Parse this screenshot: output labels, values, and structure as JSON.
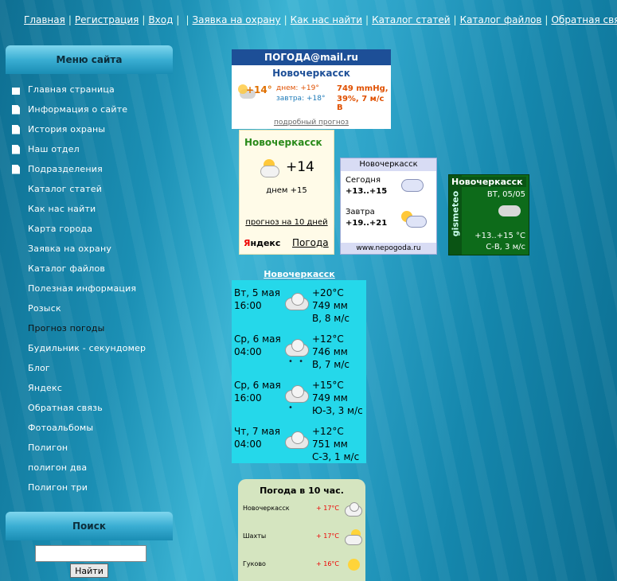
{
  "colors": {
    "accent": "#1a8db4",
    "menu_active": "#111111",
    "widget_cyan": "#25d8ea"
  },
  "topnav": [
    "Главная",
    "Регистрация",
    "Вход",
    "",
    "Заявка на охрану",
    "Как нас найти",
    "Каталог статей",
    "Каталог файлов",
    "Обратная связь"
  ],
  "sidebar": {
    "menu_title": "Меню сайта",
    "items": [
      {
        "label": "Главная страница",
        "icon": "home-icon"
      },
      {
        "label": "Информация о сайте",
        "icon": "document-icon"
      },
      {
        "label": "История охраны",
        "icon": "document-icon"
      },
      {
        "label": "Наш отдел",
        "icon": "document-icon"
      },
      {
        "label": "Подразделения",
        "icon": "document-icon"
      },
      {
        "label": "Каталог статей"
      },
      {
        "label": "Как нас найти"
      },
      {
        "label": "Карта города"
      },
      {
        "label": "Заявка на охрану"
      },
      {
        "label": "Каталог файлов"
      },
      {
        "label": "Полезная информация"
      },
      {
        "label": "Розыск"
      },
      {
        "label": "Прогноз погоды",
        "active": true
      },
      {
        "label": "Будильник - секундомер"
      },
      {
        "label": "Блог"
      },
      {
        "label": "Яндекс"
      },
      {
        "label": "Обратная связь"
      },
      {
        "label": "Фотоальбомы"
      },
      {
        "label": "Полигон"
      },
      {
        "label": "полигон два"
      },
      {
        "label": "Полигон три"
      }
    ],
    "search_title": "Поиск",
    "search_button": "Найти",
    "search_value": ""
  },
  "mail_widget": {
    "brand": "ПОГОДА@mail.ru",
    "city": "Новочеркасск",
    "temp": "+14°",
    "today": "днем: +19°",
    "tomorrow": "завтра: +18°",
    "pressure": "749 mmHg,",
    "humidity_wind": "39%, 7 м/с В",
    "more": "подробный прогноз"
  },
  "yandex_widget": {
    "city": "Новочеркасск",
    "temp": "+14",
    "day": "днем +15",
    "forecast_link": "прогноз на 10 дней",
    "logo_y": "Я",
    "logo_rest": "ндекс",
    "service": "Погода"
  },
  "nepogoda_widget": {
    "city": "Новочеркасск",
    "today_label": "Сегодня",
    "today_value": "+13..+15",
    "tomorrow_label": "Завтра",
    "tomorrow_value": "+19..+21",
    "site": "www.nepogoda.ru"
  },
  "gismeteo_widget": {
    "brand": "gismeteo",
    "city": "Новочеркасск",
    "date": "ВТ, 05/05",
    "temp": "+13..+15 °C",
    "wind": "С-В, 3 м/с"
  },
  "forecast_widget": {
    "title": "Новочеркасск",
    "rows": [
      {
        "day": "Вт, 5 мая",
        "time": "16:00",
        "temp": "+20°C",
        "pressure": "749 мм",
        "wind": "В, 8 м/с",
        "drops": ""
      },
      {
        "day": "Ср, 6 мая",
        "time": "04:00",
        "temp": "+12°C",
        "pressure": "746 мм",
        "wind": "В, 7 м/с",
        "drops": "• •"
      },
      {
        "day": "Ср, 6 мая",
        "time": "16:00",
        "temp": "+15°C",
        "pressure": "749 мм",
        "wind": "Ю-З, 3 м/с",
        "drops": "•"
      },
      {
        "day": "Чт, 7 мая",
        "time": "04:00",
        "temp": "+12°C",
        "pressure": "751 мм",
        "wind": "С-З, 1 м/с",
        "drops": ""
      }
    ]
  },
  "cities_widget": {
    "title": "Погода в 10 час.",
    "rows": [
      {
        "city": "Новочеркасск",
        "temp": "+ 17°C",
        "icon": "cloud-icon"
      },
      {
        "city": "Шахты",
        "temp": "+ 17°C",
        "icon": "sun-cloud-icon"
      },
      {
        "city": "Гуково",
        "temp": "+ 16°C",
        "icon": "sun-icon"
      }
    ]
  }
}
